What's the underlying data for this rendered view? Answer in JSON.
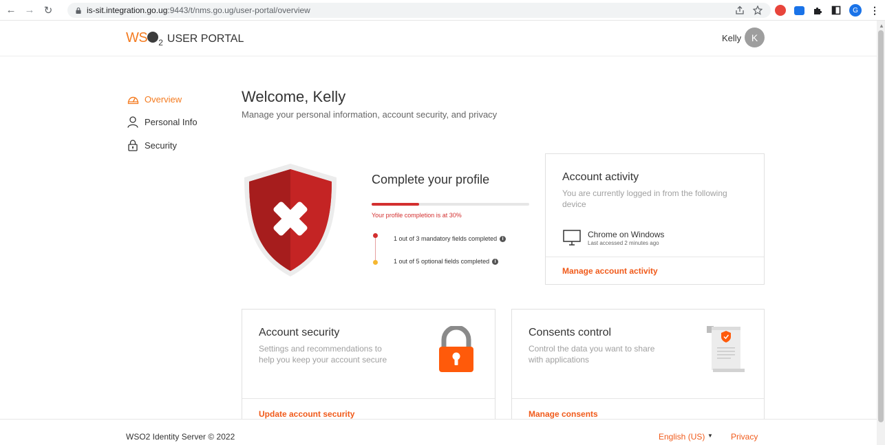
{
  "browser": {
    "url_host": "is-sit.integration.go.ug",
    "url_rest": ":9443/t/nms.go.ug/user-portal/overview",
    "profile_initial": "G"
  },
  "header": {
    "logo_wso": "WS",
    "logo_sub": "2",
    "title": "USER PORTAL",
    "user_name": "Kelly",
    "avatar_initial": "K"
  },
  "sidebar": {
    "items": [
      {
        "label": "Overview",
        "icon": "dashboard-icon",
        "active": true
      },
      {
        "label": "Personal Info",
        "icon": "person-icon",
        "active": false
      },
      {
        "label": "Security",
        "icon": "lock-icon",
        "active": false
      }
    ]
  },
  "main": {
    "welcome": "Welcome, Kelly",
    "subtitle": "Manage your personal information, account security, and privacy"
  },
  "profile": {
    "title": "Complete your profile",
    "completion_percent": 30,
    "completion_text": "Your profile completion is at 30%",
    "mandatory_text": "1 out of 3 mandatory fields completed",
    "optional_text": "1 out of 5 optional fields completed",
    "mandatory_color": "#d32f2f",
    "optional_color": "#f5b731"
  },
  "account_activity": {
    "title": "Account activity",
    "description": "You are currently logged in from the following device",
    "device": "Chrome on Windows",
    "last_accessed": "Last accessed 2 minutes ago",
    "link": "Manage account activity"
  },
  "account_security": {
    "title": "Account security",
    "description": "Settings and recommendations to help you keep your account secure",
    "link": "Update account security"
  },
  "consents": {
    "title": "Consents control",
    "description": "Control the data you want to share with applications",
    "link": "Manage consents"
  },
  "footer": {
    "copyright": "WSO2 Identity Server © 2022",
    "language": "English (US)",
    "privacy": "Privacy"
  },
  "colors": {
    "accent": "#f47b20",
    "link": "#f05a1a",
    "danger": "#d32f2f"
  }
}
